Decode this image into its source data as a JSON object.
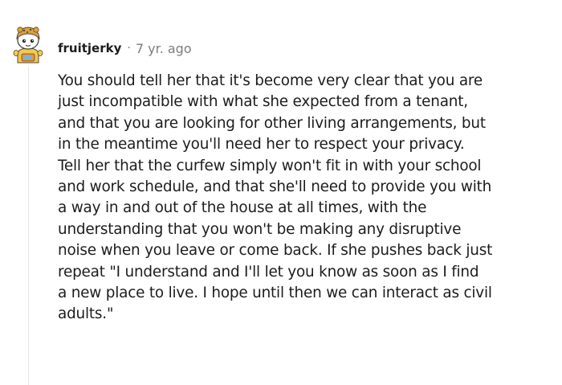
{
  "comment": {
    "author": "fruitjerky",
    "separator": "·",
    "age": "7 yr. ago",
    "body_lines": [
      "You should tell her that it's become very clear that you are",
      "just incompatible with what she expected from a tenant,",
      "and that you are looking for other living arrangements, but",
      "in the meantime you'll need her to respect your privacy.",
      "Tell her that the curfew simply won't fit in with your school",
      "and work schedule, and that she'll need to provide you with",
      "a way in and out of the house at all times, with the",
      "understanding that you won't be making any disruptive",
      "noise when you leave or come back. If she pushes back just",
      "repeat \"I understand and I'll let you know as soon as I find",
      "a new place to live. I hope until then we can interact as civil",
      "adults.\""
    ],
    "avatar_icon": "snoo-avatar-icon"
  },
  "colors": {
    "text": "#1c1c1c",
    "meta": "#7c7c7c",
    "thread_line": "#e4e7ea",
    "avatar_yellow": "#f2c94c",
    "avatar_orange": "#e8963a"
  }
}
